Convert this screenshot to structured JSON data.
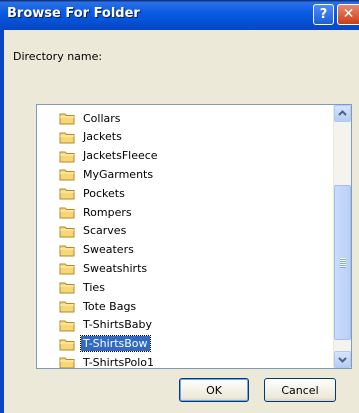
{
  "window": {
    "title": "Browse For Folder",
    "help_label": "?",
    "close_label": "✕"
  },
  "directory_label": "Directory name:",
  "folders": [
    {
      "label": "Collars"
    },
    {
      "label": "Jackets"
    },
    {
      "label": "JacketsFleece"
    },
    {
      "label": "MyGarments"
    },
    {
      "label": "Pockets"
    },
    {
      "label": "Rompers"
    },
    {
      "label": "Scarves"
    },
    {
      "label": "Sweaters"
    },
    {
      "label": "Sweatshirts"
    },
    {
      "label": "Ties"
    },
    {
      "label": "Tote Bags"
    },
    {
      "label": "T-ShirtsBaby"
    },
    {
      "label": "T-ShirtsBow",
      "selected": true
    },
    {
      "label": "T-ShirtsPolo1"
    }
  ],
  "buttons": {
    "ok": "OK",
    "cancel": "Cancel"
  },
  "colors": {
    "selection": "#316ac5",
    "folder": "#f7d675",
    "titlebar": "#0452d6"
  }
}
